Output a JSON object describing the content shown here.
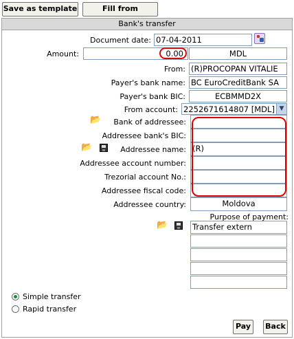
{
  "toolbar": {
    "save_template": "Save as template",
    "fill_template": "Fill from template"
  },
  "form": {
    "title": "Bank's transfer",
    "document_date": {
      "label": "Document date:",
      "value": "07-04-2011"
    },
    "amount": {
      "label": "Amount:",
      "value": "0.00",
      "currency": "MDL"
    },
    "from": {
      "label": "From:",
      "value": "(R)PROCOPAN VITALIE"
    },
    "payer_bank_name": {
      "label": "Payer's bank name:",
      "value": "BC EuroCreditBank SA"
    },
    "payer_bank_bic": {
      "label": "Payer's bank BIC:",
      "value": "ECBMMD2X"
    },
    "from_account": {
      "label": "From account:",
      "value": "2252671614807 [MDL]"
    },
    "bank_of_addressee": {
      "label": "Bank of addressee:",
      "value": ""
    },
    "addressee_bank_bic": {
      "label": "Addressee bank's BIC:",
      "value": ""
    },
    "addressee_name": {
      "label": "Addressee name:",
      "value": "(R)"
    },
    "addressee_account": {
      "label": "Addressee account number:",
      "value": ""
    },
    "trezorial_account": {
      "label": "Trezorial account No.:",
      "value": ""
    },
    "addressee_fiscal_code": {
      "label": "Addressee fiscal code:",
      "value": ""
    },
    "addressee_country": {
      "label": "Addressee country:",
      "value": "Moldova"
    },
    "purpose": {
      "label": "Purpose of payment:",
      "lines": [
        "Transfer extern",
        "",
        "",
        "",
        ""
      ]
    }
  },
  "transfer_type": {
    "simple": "Simple transfer",
    "rapid": "Rapid transfer",
    "selected": "simple"
  },
  "actions": {
    "pay": "Pay",
    "back": "Back"
  },
  "icons": {
    "calendar": "calendar-icon",
    "folder": "folder-open-icon",
    "save": "floppy-disk-icon"
  }
}
